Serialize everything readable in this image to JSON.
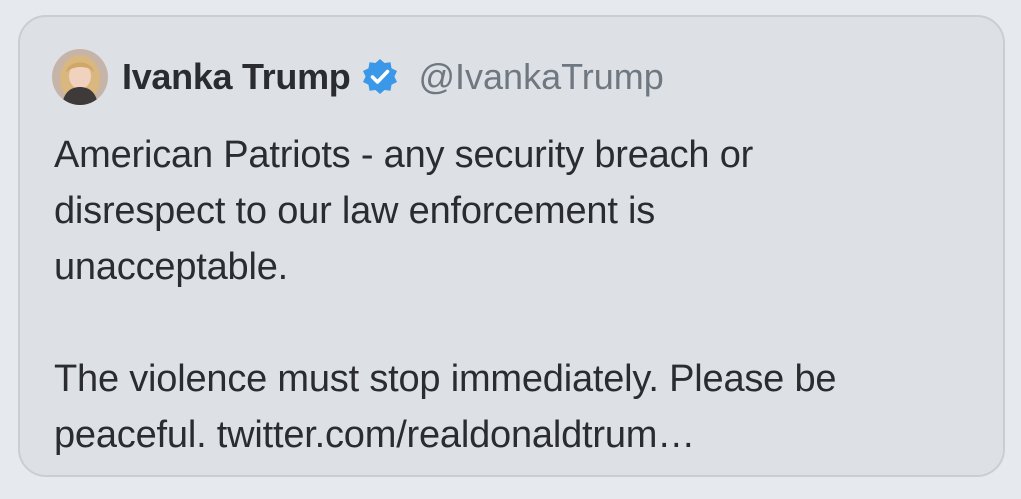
{
  "tweet": {
    "author": {
      "display_name": "Ivanka Trump",
      "handle": "@IvankaTrump",
      "verified": true,
      "avatar_icon": "profile-photo-avatar",
      "verified_icon": "verified-badge-icon",
      "verified_color": "#3b97e8"
    },
    "paragraphs": {
      "first": "American Patriots - any security breach or\ndisrespect to our law enforcement is\nunacceptable.",
      "second_text": "The violence must stop immediately. Please be\npeaceful. ",
      "second_link": "twitter.com/realdonaldtrum…"
    }
  }
}
